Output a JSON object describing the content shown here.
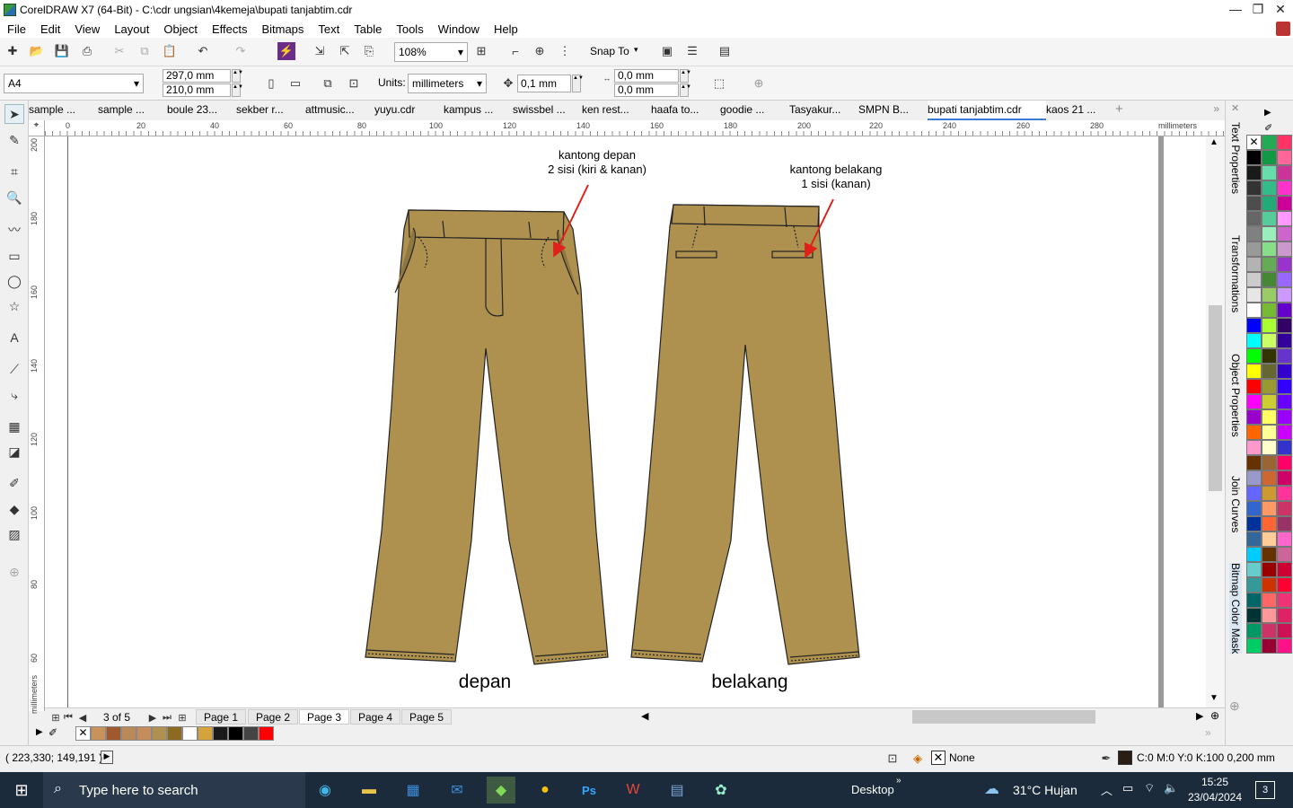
{
  "title": "CorelDRAW X7 (64-Bit) - C:\\cdr ungsian\\4kemeja\\bupati tanjabtim.cdr",
  "menu": [
    "File",
    "Edit",
    "View",
    "Layout",
    "Object",
    "Effects",
    "Bitmaps",
    "Text",
    "Table",
    "Tools",
    "Window",
    "Help"
  ],
  "toolbar": {
    "zoom": "108%",
    "snap": "Snap To"
  },
  "props": {
    "paper": "A4",
    "width": "297,0 mm",
    "height": "210,0 mm",
    "units_label": "Units:",
    "units": "millimeters",
    "nudge": "0,1 mm",
    "dup_x": "0,0 mm",
    "dup_y": "0,0 mm"
  },
  "tabs": [
    "sample ...",
    "sample ...",
    "boule 23...",
    "sekber r...",
    "attmusic...",
    "yuyu.cdr",
    "kampus ...",
    "swissbel ...",
    "ken rest...",
    "haafa to...",
    "goodie ...",
    "Tasyakur...",
    "SMPN B...",
    "bupati tanjabtim.cdr",
    "kaos 21 ..."
  ],
  "ruler": {
    "unit": "millimeters",
    "h": [
      "0",
      "20",
      "40",
      "60",
      "80",
      "100",
      "120",
      "140",
      "160",
      "180",
      "200",
      "220",
      "240",
      "260",
      "280"
    ],
    "v": [
      "200",
      "180",
      "160",
      "140",
      "120",
      "100",
      "80",
      "60"
    ],
    "v_unit": "millimeters"
  },
  "drawing": {
    "front_note_1": "kantong depan",
    "front_note_2": "2 sisi (kiri & kanan)",
    "back_note_1": "kantong belakang",
    "back_note_2": "1 sisi (kanan)",
    "front_label": "depan",
    "back_label": "belakang"
  },
  "pages": {
    "counter": "3 of 5",
    "list": [
      "Page 1",
      "Page 2",
      "Page 3",
      "Page 4",
      "Page 5"
    ]
  },
  "status": {
    "coords": "( 223,330; 149,191 )",
    "fill": "None",
    "outline": "C:0 M:0 Y:0 K:100  0,200 mm"
  },
  "dockers": [
    "Text Properties",
    "Transformations",
    "Object Properties",
    "Join Curves",
    "Bitmap Color Mask"
  ],
  "taskbar": {
    "search": "Type here to search",
    "desktop": "Desktop",
    "weather": "31°C  Hujan",
    "time": "15:25",
    "date": "23/04/2024",
    "notif": "3"
  },
  "colors": {
    "pants": "#ae914f",
    "arrow": "#e0201a",
    "taskbar": "#1c2b3c"
  }
}
